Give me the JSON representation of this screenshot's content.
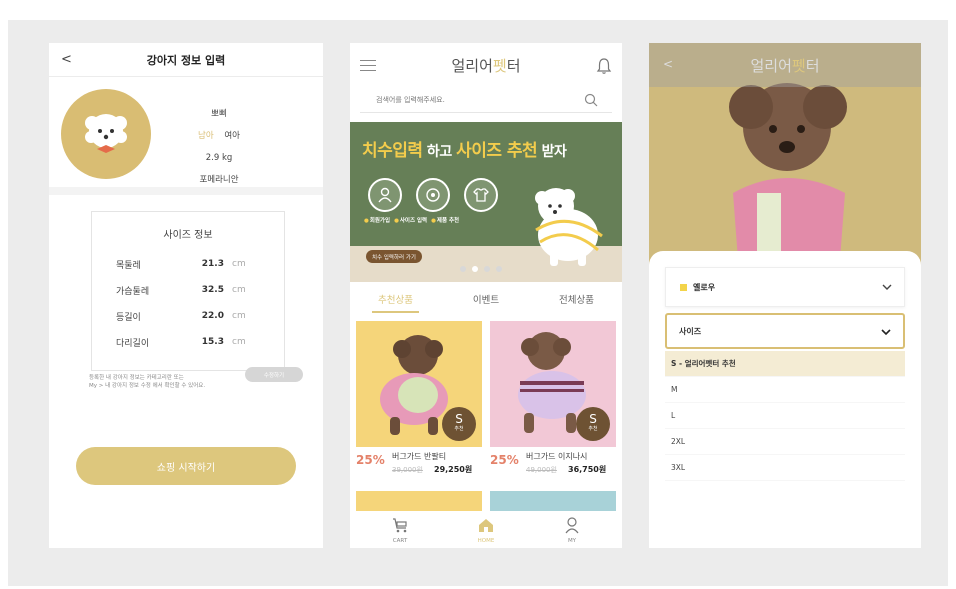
{
  "screen1": {
    "back": "<",
    "title": "강아지 정보 입력",
    "name": "뽀삐",
    "gender": [
      "남아",
      "여아"
    ],
    "weight": "2.9 kg",
    "breed": "포메라니안",
    "size_title": "사이즈 정보",
    "sizes": [
      {
        "label": "목둘레",
        "value": "21.3",
        "unit": "cm"
      },
      {
        "label": "가슴둘레",
        "value": "32.5",
        "unit": "cm"
      },
      {
        "label": "등길이",
        "value": "22.0",
        "unit": "cm"
      },
      {
        "label": "다리길이",
        "value": "15.3",
        "unit": "cm"
      }
    ],
    "note_line1": "등록한 내 강아지 정보는 카테고리란 또는",
    "note_line2": "My > 내 강아지 정보 수정 에서 확인할 수 있어요.",
    "edit_label": "수정하기",
    "start_label": "쇼핑 시작하기"
  },
  "screen2": {
    "logo_a": "얼리어",
    "logo_b": "펫",
    "logo_c": "터",
    "search_placeholder": "검색어를 입력해주세요.",
    "banner": {
      "t1": "치수입력",
      "t2": " 하고 ",
      "t3": "사이즈 추천",
      "t4": " 받자",
      "steps": [
        "회원가입",
        "사이즈 입력",
        "제품 추천"
      ],
      "button": "치수 입력하러 가기"
    },
    "tabs": [
      "추천상품",
      "이벤트",
      "전체상품"
    ],
    "products": [
      {
        "discount": "25%",
        "name": "버그가드 반팔티",
        "orig": "39,000원",
        "price": "29,250원",
        "badge": "S",
        "badge_sub": "추천"
      },
      {
        "discount": "25%",
        "name": "버그가드 이지나시",
        "orig": "49,000원",
        "price": "36,750원",
        "badge": "S",
        "badge_sub": "추천"
      }
    ],
    "nav": [
      "CART",
      "HOME",
      "MY"
    ]
  },
  "screen3": {
    "back": "<",
    "logo_a": "얼리어",
    "logo_b": "펫",
    "logo_c": "터",
    "color_value": "옐로우",
    "size_label": "사이즈",
    "size_options": [
      "S - 얼리어펫터 추천",
      "M",
      "L",
      "2XL",
      "3XL"
    ]
  }
}
